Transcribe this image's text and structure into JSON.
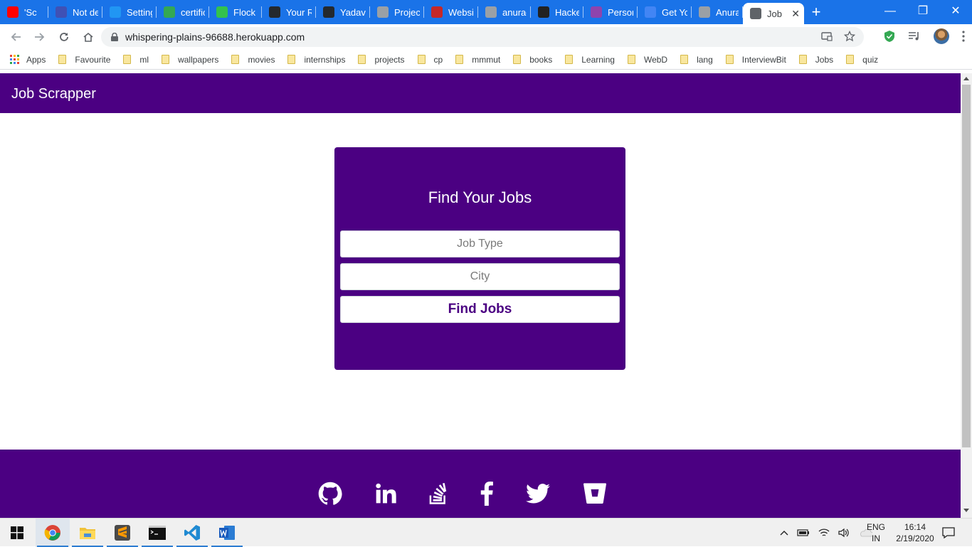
{
  "browser": {
    "tabs": [
      {
        "label": "'Sc",
        "icon": "youtube-icon",
        "color": "#ff0000"
      },
      {
        "label": "Not de",
        "icon": "mail-icon",
        "color": "#3f51b5"
      },
      {
        "label": "Setting",
        "icon": "settings-page-icon",
        "color": "#2196f3"
      },
      {
        "label": "certific",
        "icon": "google-drive-icon",
        "color": "#34a853"
      },
      {
        "label": "Flock",
        "icon": "flock-icon",
        "color": "#33c24d"
      },
      {
        "label": "Your R",
        "icon": "github-icon",
        "color": "#24292e"
      },
      {
        "label": "YadavA",
        "icon": "github-icon",
        "color": "#24292e"
      },
      {
        "label": "Project",
        "icon": "globe-icon",
        "color": "#9aa0a6"
      },
      {
        "label": "Websit",
        "icon": "codeforces-icon",
        "color": "#c62828"
      },
      {
        "label": "anurag",
        "icon": "globe-icon",
        "color": "#9aa0a6"
      },
      {
        "label": "Hacke",
        "icon": "react-icon",
        "color": "#222222"
      },
      {
        "label": "Person",
        "icon": "hashnode-icon",
        "color": "#8e44ad"
      },
      {
        "label": "Get Yo",
        "icon": "chrome-web-icon",
        "color": "#4285f4"
      },
      {
        "label": "Anurag",
        "icon": "globe-icon",
        "color": "#9aa0a6"
      },
      {
        "label": "Job",
        "icon": "globe-icon",
        "color": "#5f6368",
        "active": true
      }
    ],
    "url": "whispering-plains-96688.herokuapp.com",
    "bookmarks": [
      "Apps",
      "Favourite",
      "ml",
      "wallpapers",
      "movies",
      "internships",
      "projects",
      "cp",
      "mmmut",
      "books",
      "Learning",
      "WebD",
      "lang",
      "InterviewBit",
      "Jobs",
      "quiz"
    ]
  },
  "page": {
    "brand": "Job Scrapper",
    "form": {
      "title": "Find Your Jobs",
      "job_type_placeholder": "Job Type",
      "city_placeholder": "City",
      "submit_label": "Find Jobs"
    },
    "footer_links": [
      "github-icon",
      "linkedin-icon",
      "stackoverflow-icon",
      "facebook-icon",
      "twitter-icon",
      "bitbucket-icon"
    ],
    "colors": {
      "brand": "#4b0082",
      "background": "#ffffff"
    }
  },
  "taskbar": {
    "apps": [
      "chrome-icon",
      "file-explorer-icon",
      "sublime-text-icon",
      "terminal-icon",
      "vscode-icon",
      "word-icon"
    ],
    "language_line1": "ENG",
    "language_line2": "IN",
    "time": "16:14",
    "date": "2/19/2020"
  }
}
